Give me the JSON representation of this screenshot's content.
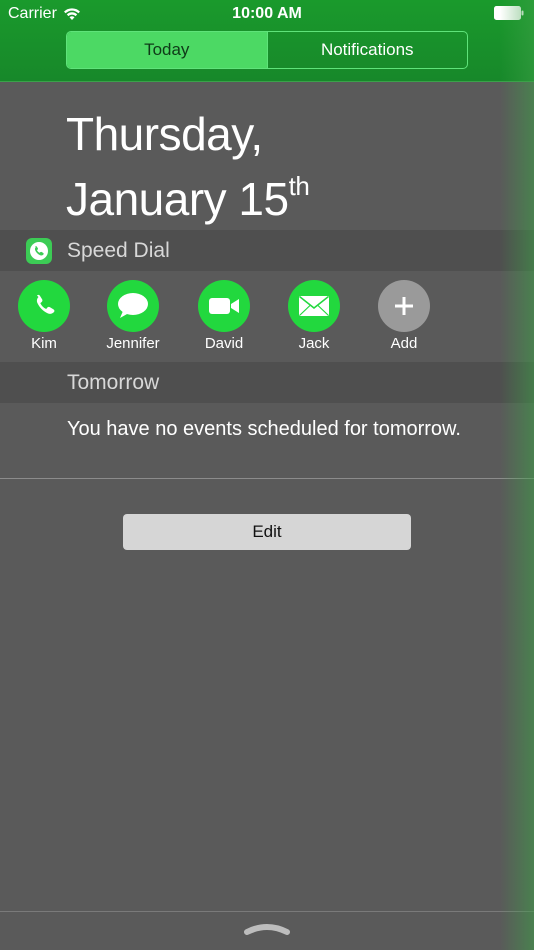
{
  "status_bar": {
    "carrier": "Carrier",
    "time": "10:00 AM",
    "wifi_icon": "wifi-icon",
    "battery_icon": "battery-icon"
  },
  "tabs": [
    {
      "label": "Today",
      "active": true
    },
    {
      "label": "Notifications",
      "active": false
    }
  ],
  "date": {
    "line1": "Thursday,",
    "line2": "January 15",
    "suffix": "th"
  },
  "speed_dial": {
    "title": "Speed Dial",
    "app_icon": "speed-dial-app-icon",
    "contacts": [
      {
        "name": "Kim",
        "icon": "phone-icon"
      },
      {
        "name": "Jennifer",
        "icon": "message-icon"
      },
      {
        "name": "David",
        "icon": "video-icon"
      },
      {
        "name": "Jack",
        "icon": "mail-icon"
      },
      {
        "name": "Add",
        "icon": "plus-icon"
      }
    ]
  },
  "tomorrow": {
    "title": "Tomorrow",
    "message": "You have no events scheduled for tomorrow."
  },
  "edit_label": "Edit",
  "colors": {
    "header_green": "#1a9a2c",
    "accent_green": "#4cd964",
    "dial_green": "#22d83e",
    "background": "#5a5a5a"
  }
}
